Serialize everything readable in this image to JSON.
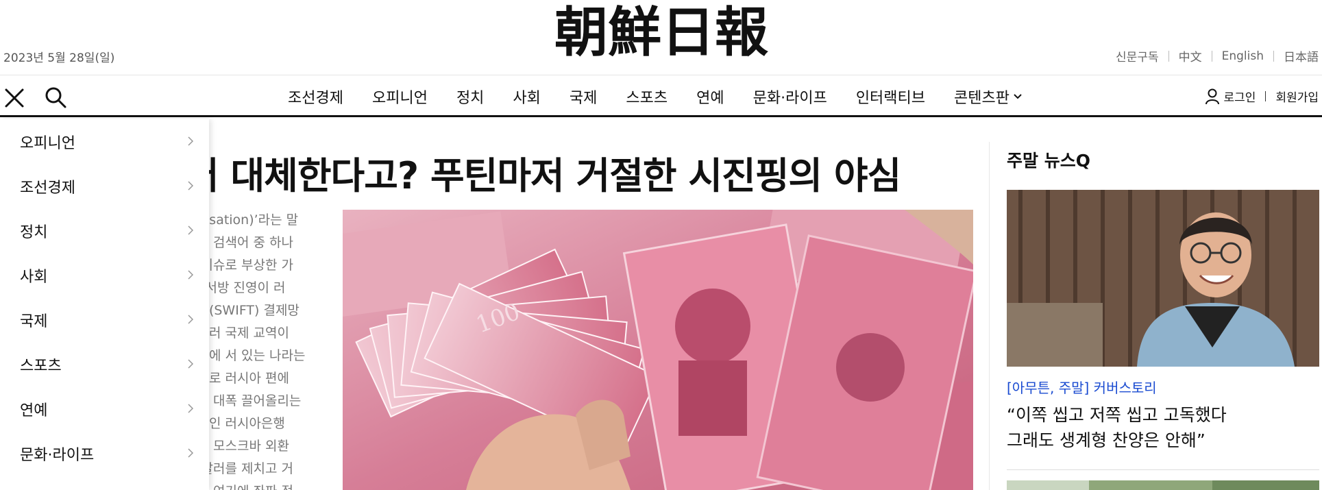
{
  "header": {
    "date": "2023년 5월 28일(일)",
    "logo_text": "朝鮮日報",
    "links": [
      "신문구독",
      "中文",
      "English",
      "日本語"
    ]
  },
  "nav": {
    "items": [
      "조선경제",
      "오피니언",
      "정치",
      "사회",
      "국제",
      "스포츠",
      "연예",
      "문화·라이프",
      "인터랙티브",
      "콘텐츠판"
    ],
    "login": "로그인",
    "signup": "회원가입"
  },
  "side_menu": {
    "items": [
      "오피니언",
      "조선경제",
      "정치",
      "사회",
      "국제",
      "스포츠",
      "연예",
      "문화·라이프"
    ]
  },
  "article": {
    "headline": "러 대체한다고? 푸틴마저 거절한 시진핑의 야심",
    "body_lines": [
      "llarisation)’라는 말",
      " 주요 검색어 중 하나",
      "제 이슈로 부상한 가",
      "다. 서방 진영이 러",
      "협회(SWIFT) 결제망",
      "비달러 국제 교역이",
      "중심에 서 있는 나라는",
      "적으로 러시아 편에",
      "등을 대폭 끌어올리는",
      "은행인 러시아은행",
      "에는 모스크바 외환",
      "로 달러를 제치고 거",
      "했다.여기에 좌파 정"
    ]
  },
  "sidebar": {
    "title": "주말 뉴스Q",
    "kicker": "[아무튼, 주말] 커버스토리",
    "headline_lines": [
      "“이쪽 씹고 저쪽 씹고 고독했다",
      "그래도 생계형 찬양은 안해”"
    ]
  },
  "colors": {
    "kicker": "#1a4bd1",
    "rule": "#111111",
    "banknote": "#d9708c"
  }
}
